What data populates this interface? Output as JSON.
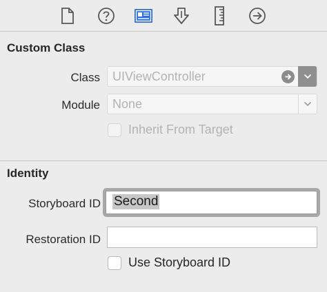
{
  "toolbar": {
    "icons": [
      {
        "name": "file-inspector-icon"
      },
      {
        "name": "quick-help-icon"
      },
      {
        "name": "identity-inspector-icon",
        "selected": true
      },
      {
        "name": "attributes-inspector-icon"
      },
      {
        "name": "size-inspector-icon"
      },
      {
        "name": "connections-inspector-icon"
      }
    ],
    "selected_color": "#2f6fdc"
  },
  "custom_class": {
    "title": "Custom Class",
    "class_label": "Class",
    "class_value": "UIViewController",
    "module_label": "Module",
    "module_value": "None",
    "inherit_label": "Inherit From Target",
    "inherit_checked": false
  },
  "identity": {
    "title": "Identity",
    "storyboard_id_label": "Storyboard ID",
    "storyboard_id_value": "Second",
    "restoration_id_label": "Restoration ID",
    "restoration_id_value": "",
    "use_storyboard_label": "Use Storyboard ID",
    "use_storyboard_checked": false
  }
}
